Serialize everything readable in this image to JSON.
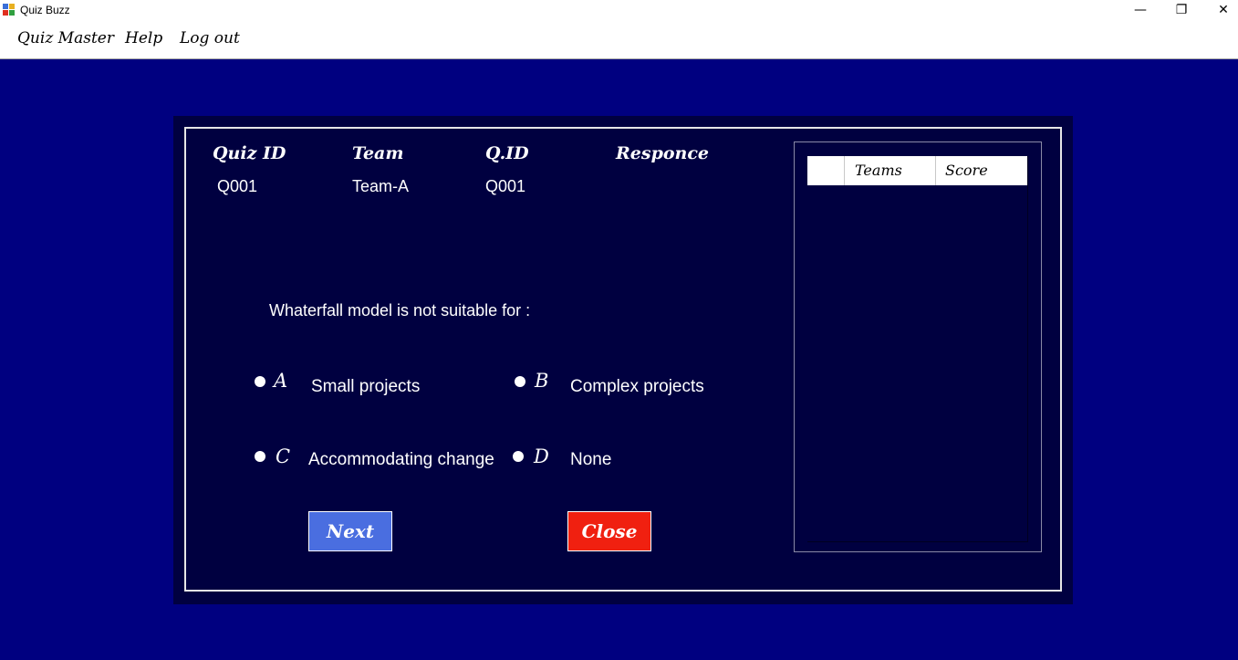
{
  "window": {
    "title": "Quiz Buzz",
    "controls": {
      "minimize": "—",
      "maximize": "❐",
      "close": "✕"
    }
  },
  "menu": {
    "items": [
      "Quiz Master",
      "Help",
      "Log out"
    ]
  },
  "quiz": {
    "headers": {
      "quiz_id": "Quiz ID",
      "team": "Team",
      "qid": "Q.ID",
      "response": "Responce"
    },
    "values": {
      "quiz_id": "Q001",
      "team": "Team-A",
      "qid": "Q001",
      "response": ""
    },
    "question": "Whaterfall model is not suitable for :",
    "options": [
      {
        "letter": "A",
        "text": "Small projects"
      },
      {
        "letter": "B",
        "text": "Complex projects"
      },
      {
        "letter": "C",
        "text": "Accommodating change"
      },
      {
        "letter": "D",
        "text": "None"
      }
    ],
    "buttons": {
      "next": "Next",
      "close": "Close"
    }
  },
  "scoreboard": {
    "columns": [
      "",
      "Teams",
      "Score"
    ],
    "rows": []
  },
  "colors": {
    "background": "#000080",
    "panel": "#000040",
    "next_button": "#4a6ee0",
    "close_button": "#f02010"
  }
}
